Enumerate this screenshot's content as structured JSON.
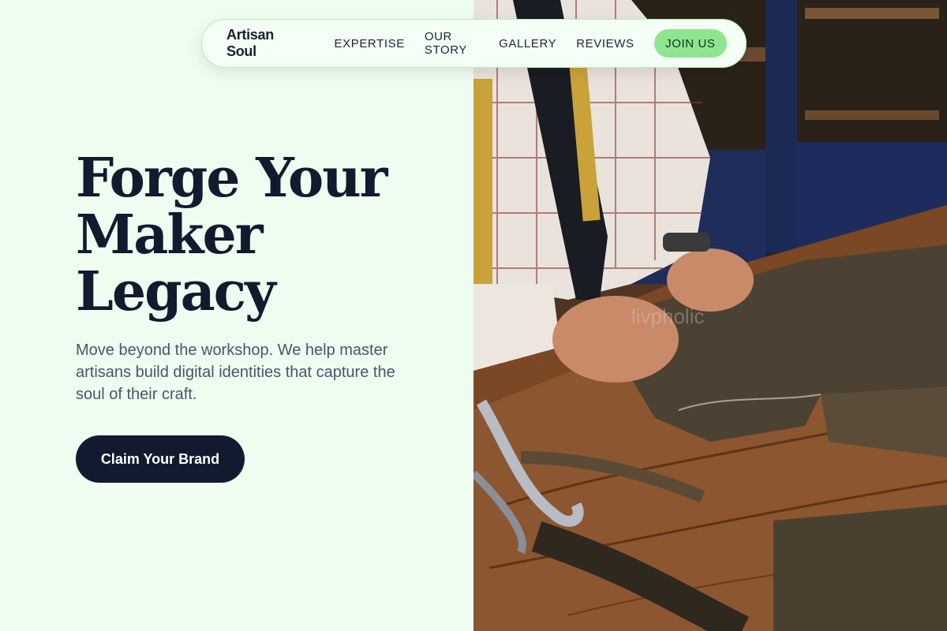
{
  "nav": {
    "brand": "Artisan Soul",
    "links": [
      "EXPERTISE",
      "OUR STORY",
      "GALLERY",
      "REVIEWS"
    ],
    "cta": "JOIN US"
  },
  "hero": {
    "title_lines": [
      "Forge Your",
      "Maker",
      "Legacy"
    ],
    "description": "Move beyond the workshop. We help master artisans build digital identities that capture the soul of their craft.",
    "button": "Claim Your Brand"
  },
  "photo": {
    "subject": "tailor-cutting-tweed-fabric-photo",
    "watermark": "livpholic"
  },
  "colors": {
    "background": "#eefdf0",
    "ink": "#111a2e",
    "accent": "#8fe58f"
  }
}
